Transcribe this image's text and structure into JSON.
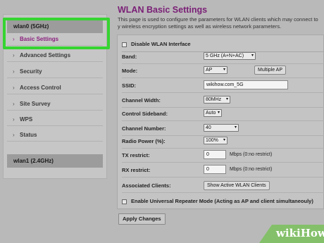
{
  "sidebar": {
    "groups": [
      {
        "label": "wlan0 (5GHz)"
      },
      {
        "label": "wlan1 (2.4GHz)"
      }
    ],
    "items": [
      {
        "label": "Basic Settings",
        "active": true
      },
      {
        "label": "Advanced Settings"
      },
      {
        "label": "Security"
      },
      {
        "label": "Access Control"
      },
      {
        "label": "Site Survey"
      },
      {
        "label": "WPS"
      },
      {
        "label": "Status"
      }
    ],
    "chevron": "›"
  },
  "main": {
    "title": "WLAN Basic Settings",
    "description": "This page is used to configure the parameters for WLAN clients which may connect to y wireless encryption settings as well as wireless network parameters.",
    "disable_wlan": {
      "label": "Disable WLAN Interface",
      "checked": false
    },
    "fields": {
      "band": {
        "label": "Band:",
        "value": "5 GHz (A+N+AC)"
      },
      "mode": {
        "label": "Mode:",
        "value": "AP",
        "button": "Multiple AP"
      },
      "ssid": {
        "label": "SSID:",
        "value": "wikihow.com_5G"
      },
      "channel_width": {
        "label": "Channel Width:",
        "value": "80MHz"
      },
      "control_sideband": {
        "label": "Control Sideband:",
        "value": "Auto"
      },
      "channel_number": {
        "label": "Channel Number:",
        "value": "40"
      },
      "radio_power": {
        "label": "Radio Power (%):",
        "value": "100%"
      },
      "tx_restrict": {
        "label": "TX restrict:",
        "value": "0",
        "hint": "Mbps (0:no restrict)"
      },
      "rx_restrict": {
        "label": "RX restrict:",
        "value": "0",
        "hint": "Mbps (0:no restrict)"
      },
      "associated_clients": {
        "label": "Associated Clients:",
        "button": "Show Active WLAN Clients"
      }
    },
    "repeater": {
      "label": "Enable Universal Repeater Mode (Acting as AP and client simultaneouly)",
      "checked": false
    },
    "apply_button": "Apply Changes"
  },
  "watermark": {
    "brand": "wikiHow"
  },
  "colors": {
    "accent": "#7a1f76",
    "highlight": "#36d431",
    "background": "#b9b9b9"
  }
}
